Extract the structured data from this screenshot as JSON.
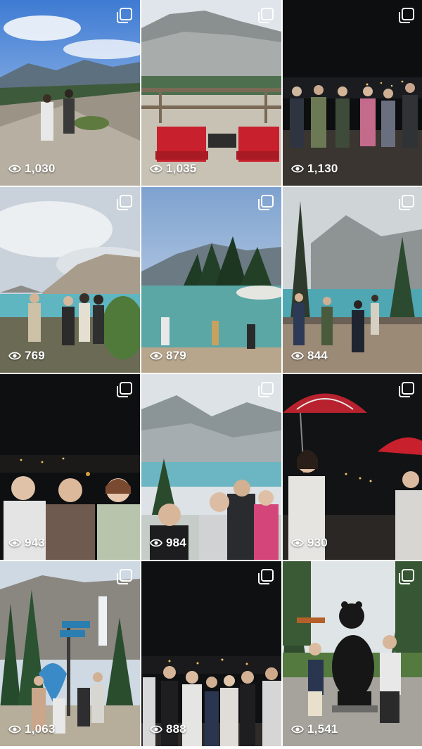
{
  "grid": {
    "posts": [
      {
        "views": "1,030",
        "scene": "mountain-valley-jump",
        "multi": true
      },
      {
        "views": "1,035",
        "scene": "red-chairs-lake",
        "multi": true
      },
      {
        "views": "1,130",
        "scene": "night-group",
        "multi": true
      },
      {
        "views": "769",
        "scene": "bow-lake-group",
        "multi": true
      },
      {
        "views": "879",
        "scene": "lake-dock",
        "multi": true
      },
      {
        "views": "844",
        "scene": "misty-lake-group",
        "multi": true
      },
      {
        "views": "943",
        "scene": "night-selfie",
        "multi": true
      },
      {
        "views": "984",
        "scene": "peyto-lake-group",
        "multi": true
      },
      {
        "views": "930",
        "scene": "umbrella-night",
        "multi": true
      },
      {
        "views": "1,063",
        "scene": "waterfall-sign-group",
        "multi": true
      },
      {
        "views": "888",
        "scene": "night-group-2",
        "multi": true
      },
      {
        "views": "1,541",
        "scene": "bear-statue",
        "multi": true
      }
    ]
  },
  "icons": {
    "views": "eye-icon",
    "multi": "multiple-photos-icon"
  }
}
